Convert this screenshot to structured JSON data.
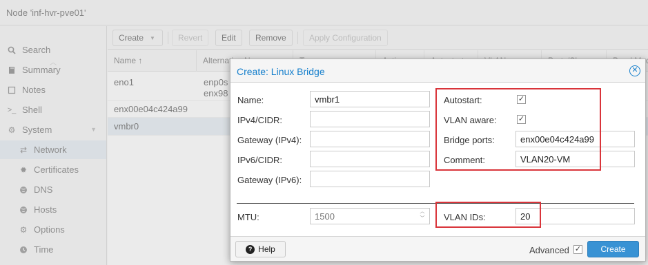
{
  "node_title": "Node 'inf-hvr-pve01'",
  "sidebar": {
    "items": [
      {
        "label": "Search",
        "icon": "search-icon"
      },
      {
        "label": "Summary",
        "icon": "book-icon"
      },
      {
        "label": "Notes",
        "icon": "notes-icon"
      },
      {
        "label": "Shell",
        "icon": "terminal-icon"
      },
      {
        "label": "System",
        "icon": "gears-icon"
      },
      {
        "label": "Network",
        "icon": "exchange-icon"
      },
      {
        "label": "Certificates",
        "icon": "certificate-icon"
      },
      {
        "label": "DNS",
        "icon": "globe-icon"
      },
      {
        "label": "Hosts",
        "icon": "globe-icon"
      },
      {
        "label": "Options",
        "icon": "gear-icon"
      },
      {
        "label": "Time",
        "icon": "clock-icon"
      }
    ]
  },
  "toolbar": {
    "create": "Create",
    "revert": "Revert",
    "edit": "Edit",
    "remove": "Remove",
    "apply": "Apply Configuration"
  },
  "grid": {
    "headers": [
      "Name ↑",
      "Alternative Names",
      "Type",
      "Active",
      "Autostart",
      "VLAN aware",
      "Ports/Slaves",
      "Bond Mode"
    ],
    "rows": [
      {
        "name": "eno1",
        "alt1": "enp0s",
        "alt2": "enx98"
      },
      {
        "name": "enx00e04c424a99",
        "alt1": "",
        "alt2": ""
      },
      {
        "name": "vmbr0",
        "alt1": "",
        "alt2": ""
      }
    ]
  },
  "dialog": {
    "title": "Create: Linux Bridge",
    "labels": {
      "name": "Name:",
      "ipv4": "IPv4/CIDR:",
      "gw4": "Gateway (IPv4):",
      "ipv6": "IPv6/CIDR:",
      "gw6": "Gateway (IPv6):",
      "autostart": "Autostart:",
      "vlan_aware": "VLAN aware:",
      "bridge_ports": "Bridge ports:",
      "comment": "Comment:",
      "mtu": "MTU:",
      "vlan_ids": "VLAN IDs:",
      "advanced": "Advanced"
    },
    "values": {
      "name": "vmbr1",
      "ipv4": "",
      "gw4": "",
      "ipv6": "",
      "gw6": "",
      "bridge_ports": "enx00e04c424a99",
      "comment": "VLAN20-VM",
      "mtu_placeholder": "1500",
      "vlan_ids": "20"
    },
    "checks": {
      "autostart": true,
      "vlan_aware": true,
      "advanced": true
    },
    "help": "Help",
    "create": "Create",
    "highlight_color": "#d9343a"
  }
}
